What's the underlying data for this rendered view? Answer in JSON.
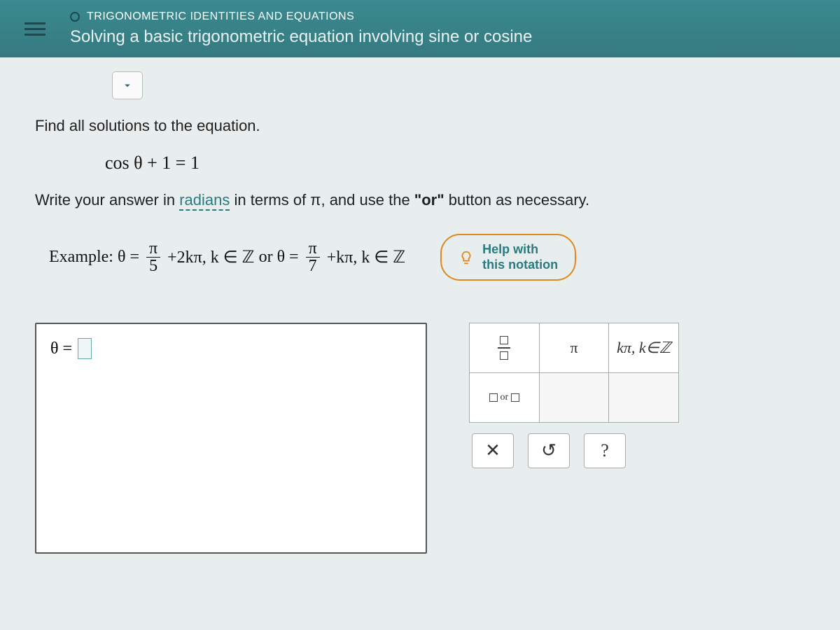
{
  "header": {
    "category": "TRIGONOMETRIC IDENTITIES AND EQUATIONS",
    "subtitle": "Solving a basic trigonometric equation involving sine or cosine"
  },
  "problem": {
    "prompt1": "Find all solutions to the equation.",
    "equation": "cos θ + 1 = 1",
    "prompt2_pre": "Write your answer in ",
    "radians_word": "radians",
    "prompt2_mid": " in terms of π, and use the ",
    "or_literal": "\"or\"",
    "prompt2_post": " button as necessary."
  },
  "example": {
    "label": "Example:",
    "theta": "θ =",
    "frac1_num": "π",
    "frac1_den": "5",
    "term1": "+2kπ, k ∈ ℤ",
    "or": "or",
    "frac2_num": "π",
    "frac2_den": "7",
    "term2": "+kπ, k ∈ ℤ"
  },
  "help": {
    "line1": "Help with",
    "line2": "this notation"
  },
  "answer": {
    "theta_label": "θ ="
  },
  "palette": {
    "pi": "π",
    "kpz": "kπ, k∈ℤ",
    "or_text": "or",
    "clear": "✕",
    "reset": "↺",
    "help": "?"
  }
}
